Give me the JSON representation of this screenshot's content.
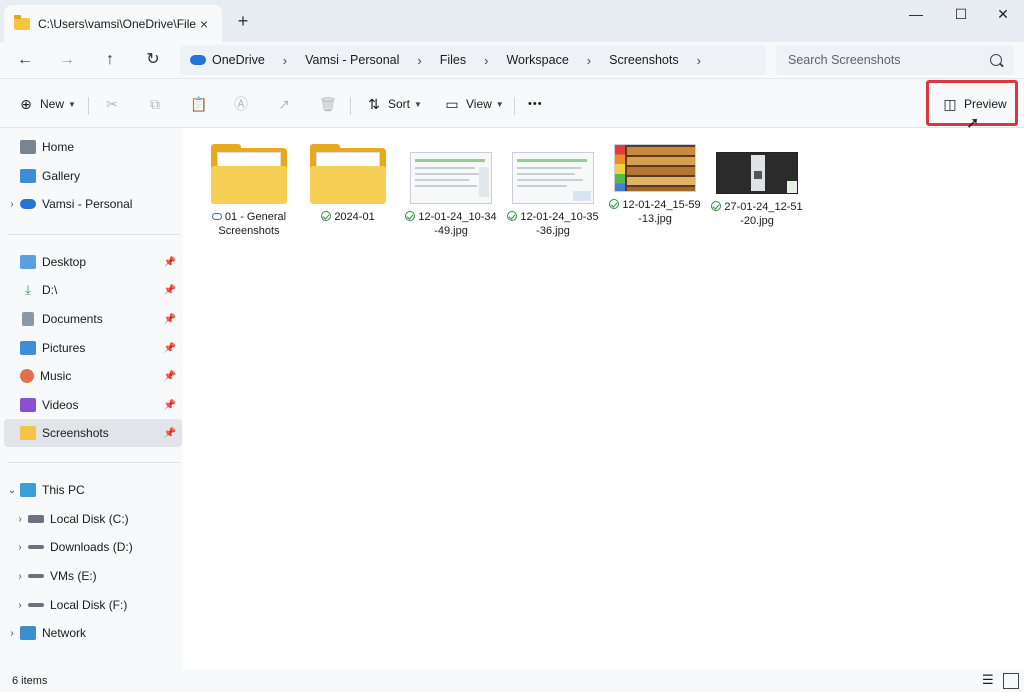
{
  "window": {
    "tab_title": "C:\\Users\\vamsi\\OneDrive\\Files",
    "tab_close": "×",
    "new_tab": "+",
    "minimize": "—",
    "maximize": "☐",
    "close": "✕"
  },
  "address": {
    "breadcrumbs": [
      "OneDrive",
      "Vamsi - Personal",
      "Files",
      "Workspace",
      "Screenshots"
    ],
    "separator": "›",
    "search_placeholder": "Search Screenshots"
  },
  "toolbar": {
    "new_label": "New",
    "sort_label": "Sort",
    "view_label": "View",
    "more_label": "•••",
    "preview_label": "Preview"
  },
  "sidebar": {
    "quick": [
      {
        "label": "Home",
        "icon": "home-icon"
      },
      {
        "label": "Gallery",
        "icon": "gallery-icon"
      },
      {
        "label": "Vamsi - Personal",
        "icon": "onedrive-icon"
      }
    ],
    "pinned": [
      {
        "label": "Desktop",
        "icon": "desktop-icon"
      },
      {
        "label": "D:\\",
        "icon": "download-icon"
      },
      {
        "label": "Documents",
        "icon": "documents-icon"
      },
      {
        "label": "Pictures",
        "icon": "pictures-icon"
      },
      {
        "label": "Music",
        "icon": "music-icon"
      },
      {
        "label": "Videos",
        "icon": "videos-icon"
      },
      {
        "label": "Screenshots",
        "icon": "folder-icon"
      }
    ],
    "this_pc": "This PC",
    "drives": [
      {
        "label": "Local Disk (C:)"
      },
      {
        "label": "Downloads (D:)"
      },
      {
        "label": "VMs (E:)"
      },
      {
        "label": "Local Disk (F:)"
      }
    ],
    "network": "Network"
  },
  "files": [
    {
      "name": "01 - General Screenshots",
      "line1": "01 - General",
      "line2": "Screenshots",
      "kind": "folder",
      "status": "cloud"
    },
    {
      "name": "2024-01",
      "line1": "2024-01",
      "line2": "",
      "kind": "folder",
      "status": "synced"
    },
    {
      "name": "12-01-24_10-34-49.jpg",
      "line1": "12-01-24_10-34",
      "line2": "-49.jpg",
      "kind": "image",
      "status": "synced"
    },
    {
      "name": "12-01-24_10-35-36.jpg",
      "line1": "12-01-24_10-35",
      "line2": "-36.jpg",
      "kind": "image",
      "status": "synced"
    },
    {
      "name": "12-01-24_15-59-13.jpg",
      "line1": "12-01-24_15-59",
      "line2": "-13.jpg",
      "kind": "image",
      "status": "synced"
    },
    {
      "name": "27-01-24_12-51-20.jpg",
      "line1": "27-01-24_12-51",
      "line2": "-20.jpg",
      "kind": "image",
      "status": "synced"
    }
  ],
  "status": {
    "item_count": "6 items"
  },
  "colors": {
    "highlight_box": "#d9363e",
    "accent": "#2473d6",
    "synced": "#2e8b43"
  }
}
